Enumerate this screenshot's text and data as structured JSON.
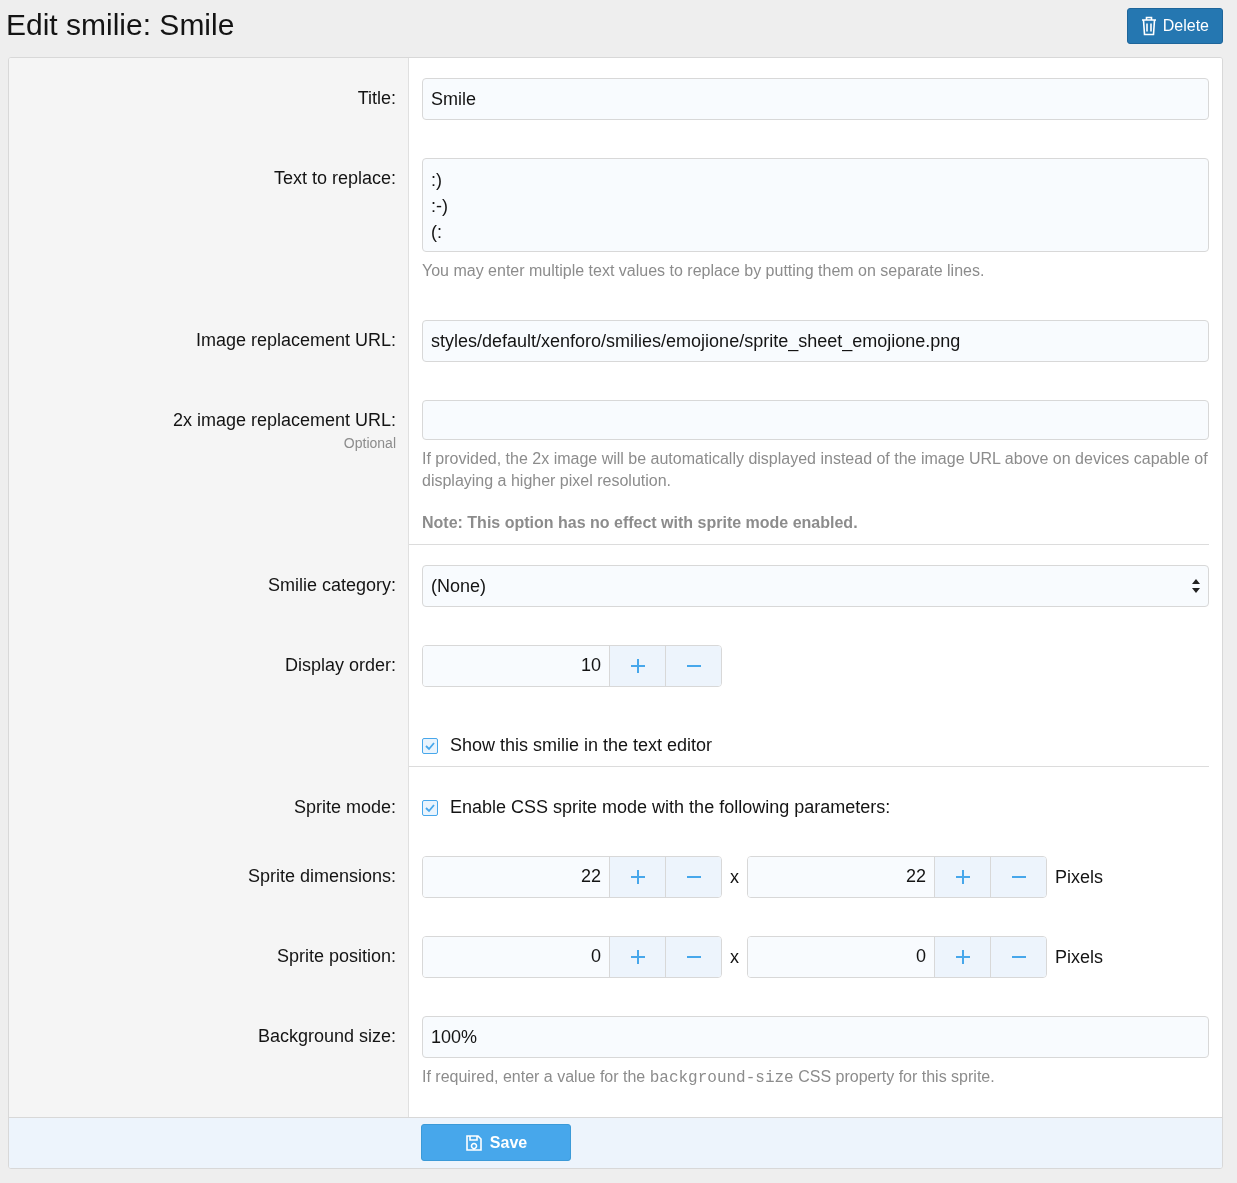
{
  "page_title": "Edit smilie: Smile",
  "delete_button": "Delete",
  "rows": [
    {
      "kind": "text",
      "label": "Title:",
      "value": "Smile",
      "divider_after": false
    },
    {
      "kind": "textarea",
      "label": "Text to replace:",
      "lines": [
        ":)",
        ":-)",
        "(:"
      ],
      "hint": "You may enter multiple text values to replace by putting them on separate lines.",
      "divider_after": false
    },
    {
      "kind": "text",
      "label": "Image replacement URL:",
      "value": "styles/default/xenforo/smilies/emojione/sprite_sheet_emojione.png",
      "divider_after": false
    },
    {
      "kind": "text",
      "label": "2x image replacement URL:",
      "sublabel": "Optional",
      "hint": "If provided, the 2x image will be automatically displayed instead of the image URL above on devices capable of displaying a higher pixel resolution.",
      "note": "Note: This option has no effect with sprite mode enabled.",
      "divider_after": true
    },
    {
      "kind": "select",
      "label": "Smilie category:",
      "value": "(None)",
      "divider_after": false
    },
    {
      "kind": "spinner",
      "label": "Display order:",
      "value": "10",
      "divider_after": false
    },
    {
      "kind": "checkbox",
      "checked": true,
      "text": "Show this smilie in the text editor",
      "divider_after": true
    },
    {
      "kind": "checkbox",
      "label": "Sprite mode:",
      "checked": true,
      "text": "Enable CSS sprite mode with the following parameters:",
      "divider_after": false
    },
    {
      "kind": "pair",
      "label": "Sprite dimensions:",
      "values": [
        "22",
        "22"
      ],
      "separator": "x",
      "unit": "Pixels",
      "divider_after": false
    },
    {
      "kind": "pair",
      "label": "Sprite position:",
      "values": [
        "0",
        "0"
      ],
      "separator": "x",
      "unit": "Pixels",
      "divider_after": false
    },
    {
      "kind": "text",
      "label": "Background size:",
      "value": "100%",
      "hint_parts": [
        "If required, enter a value for the ",
        "background-size",
        " CSS property for this sprite."
      ],
      "divider_after": false
    }
  ],
  "save_button": "Save"
}
